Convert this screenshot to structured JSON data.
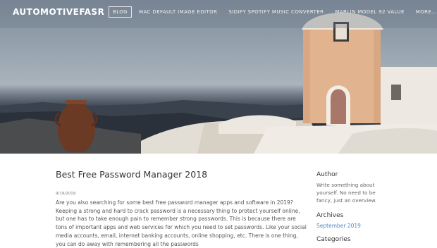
{
  "header": {
    "brand": "AUTOMOTIVEFASR",
    "nav": [
      {
        "label": "BLOG",
        "active": true
      },
      {
        "label": "MAC DEFAULT IMAGE EDITOR"
      },
      {
        "label": "SIDIFY SPOTIFY MUSIC CONVERTER"
      },
      {
        "label": "MARLIN MODEL 92 VALUE"
      },
      {
        "label": "MORE..."
      }
    ]
  },
  "post": {
    "title": "Best Free Password Manager 2018",
    "date": "9/19/2019",
    "body": "Are you also searching for some best free password manager apps and software in 2019? Keeping a strong and hard to crack password is a necessary thing to protect yourself online, but one has to take enough pain to remember strong passwords. This is because there are tons of important apps and web services for which you need to set passwords. Like your social media accounts, email, internet banking accounts, online shopping, etc. There is one thing, you can do away with remembering all the passwords"
  },
  "sidebar": {
    "author_heading": "Author",
    "author_text": "Write something about yourself. No need to be fancy, just an overview.",
    "archives_heading": "Archives",
    "archive_link": "September 2019",
    "categories_heading": "Categories"
  },
  "colors": {
    "link": "#4a8bc2",
    "text": "#555555",
    "heading": "#333333"
  }
}
